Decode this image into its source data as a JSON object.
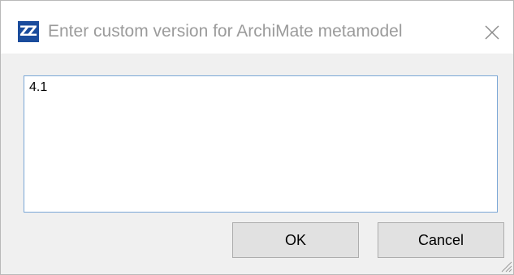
{
  "window": {
    "title": "Enter custom version for ArchiMate metamodel",
    "app_icon_glyph": "ZZ",
    "close_glyph": "close-icon"
  },
  "input": {
    "value": "4.1"
  },
  "buttons": {
    "ok_label": "OK",
    "cancel_label": "Cancel"
  },
  "colors": {
    "icon_background": "#1a4c9c",
    "input_border": "#7aa7d6",
    "title_text": "#9b9b9b",
    "button_background": "#e1e1e1"
  }
}
